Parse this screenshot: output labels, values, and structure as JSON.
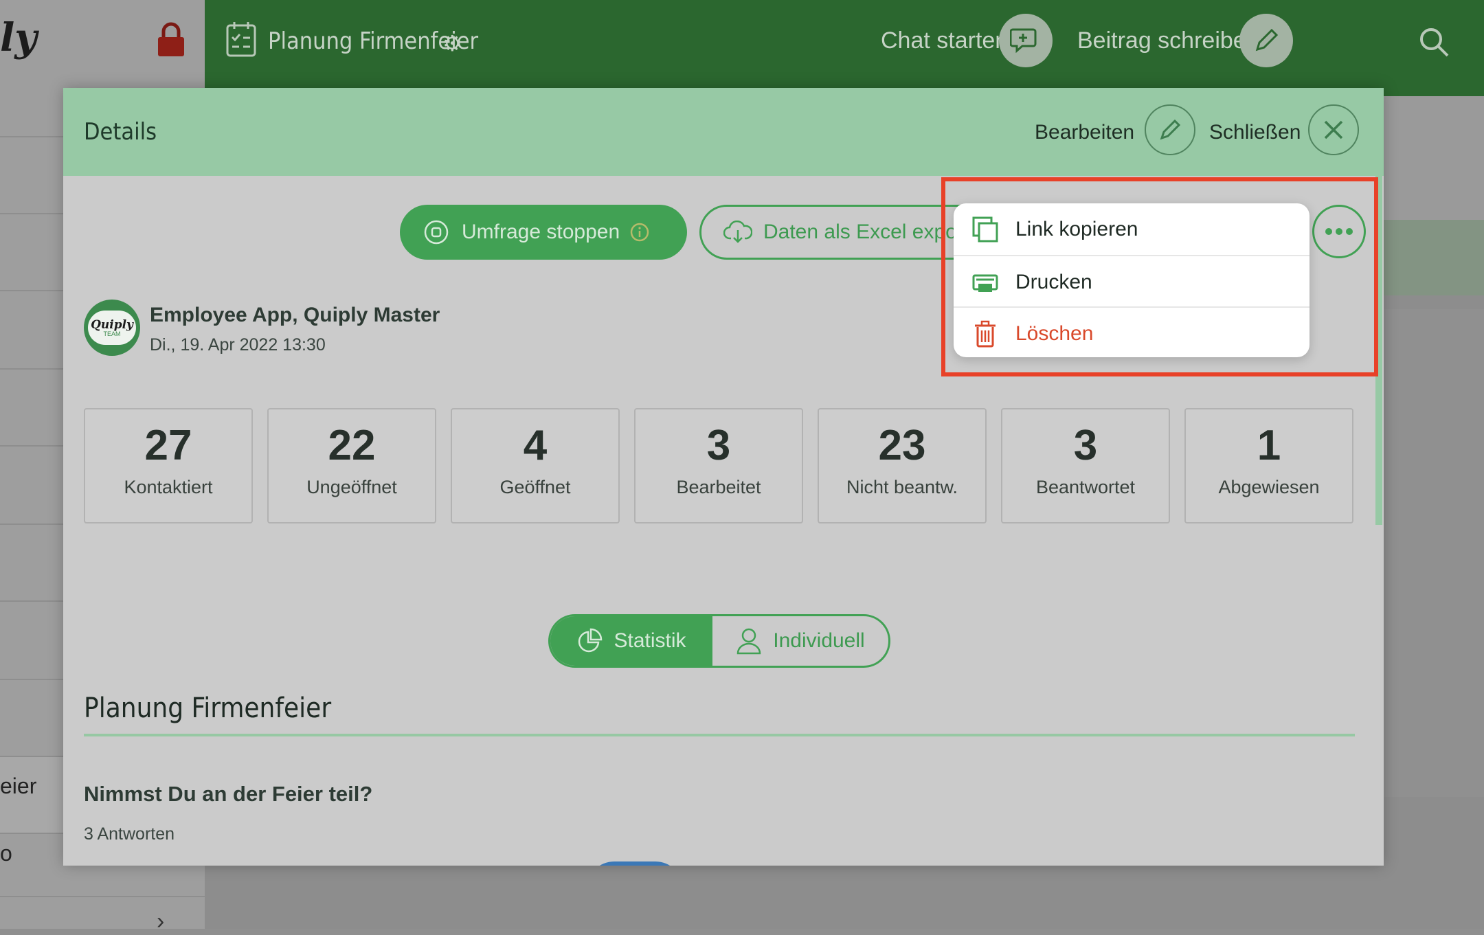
{
  "background": {
    "brand": "ly",
    "topbar": {
      "title": "Planung Firmenfeier",
      "chat_label": "Chat starten",
      "post_label": "Beitrag schreiben"
    },
    "sidebar": {
      "label_1": "eier",
      "label_2": "o",
      "chevron": "›"
    }
  },
  "modal": {
    "title": "Details",
    "edit_label": "Bearbeiten",
    "close_label": "Schließen",
    "actions": {
      "stop_survey": "Umfrage stoppen",
      "export": "Daten als Excel exportieren"
    },
    "author": {
      "avatar_text": "Quiply",
      "avatar_sub": "TEAM",
      "name": "Employee App, Quiply Master",
      "date": "Di., 19. Apr 2022 13:30"
    },
    "stats": [
      {
        "value": "27",
        "label": "Kontaktiert"
      },
      {
        "value": "22",
        "label": "Ungeöffnet"
      },
      {
        "value": "4",
        "label": "Geöffnet"
      },
      {
        "value": "3",
        "label": "Bearbeitet"
      },
      {
        "value": "23",
        "label": "Nicht beantw."
      },
      {
        "value": "3",
        "label": "Beantwortet"
      },
      {
        "value": "1",
        "label": "Abgewiesen"
      }
    ],
    "tabs": {
      "statistik": "Statistik",
      "individuell": "Individuell",
      "active": "statistik"
    },
    "survey": {
      "title": "Planung Firmenfeier",
      "question": "Nimmst Du an der Feier teil?",
      "answers_count": "3 Antworten"
    }
  },
  "menu": {
    "items": [
      {
        "label": "Link kopieren",
        "icon": "copy-icon"
      },
      {
        "label": "Drucken",
        "icon": "printer-icon"
      },
      {
        "label": "Löschen",
        "icon": "trash-icon"
      }
    ]
  },
  "colors": {
    "primary_green": "#41a154",
    "header_green": "#97c9a5",
    "topbar_green": "#2b672f",
    "danger": "#d9492b",
    "highlight": "#e84128"
  }
}
